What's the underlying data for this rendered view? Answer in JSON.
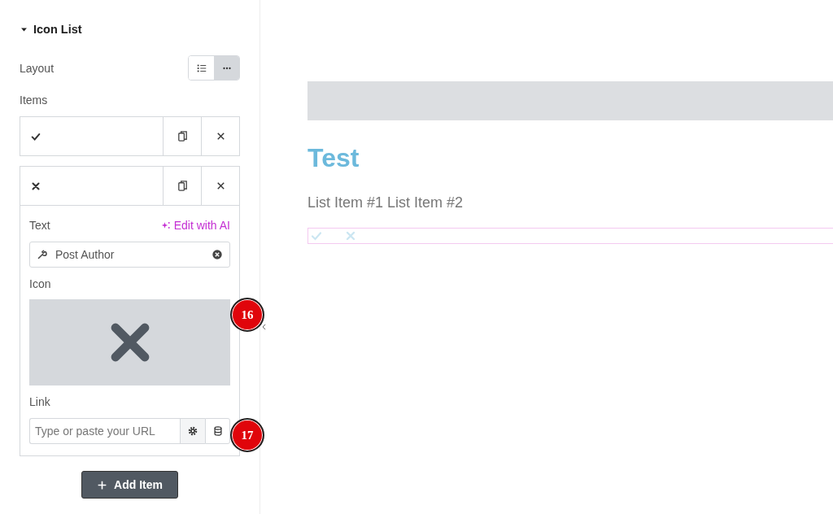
{
  "section": {
    "title": "Icon List",
    "expanded": true
  },
  "layout": {
    "label": "Layout",
    "options": [
      {
        "kind": "list",
        "selected": false
      },
      {
        "kind": "inline",
        "selected": true
      }
    ]
  },
  "items_label": "Items",
  "items": [
    {
      "kind": "check",
      "expanded": false
    },
    {
      "kind": "times",
      "expanded": true,
      "text_label": "Text",
      "ai_link": "Edit with AI",
      "text_value": "Post Author",
      "icon_label": "Icon",
      "link_label": "Link",
      "link_placeholder": "Type or paste your URL"
    }
  ],
  "add_button": "Add Item",
  "badges": [
    "16",
    "17"
  ],
  "preview": {
    "heading": "Test",
    "list_text": "List Item #1 List Item #2",
    "icons": [
      {
        "kind": "check"
      },
      {
        "kind": "times"
      }
    ]
  }
}
